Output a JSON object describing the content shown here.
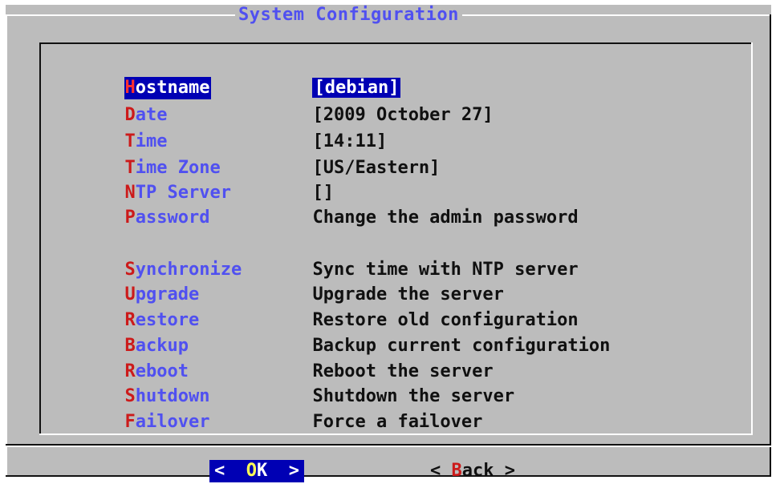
{
  "dialog": {
    "title": "System Configuration"
  },
  "menu": {
    "items": [
      {
        "hot": "H",
        "rest": "ostname",
        "value": "[debian]",
        "selected": true
      },
      {
        "hot": "D",
        "rest": "ate",
        "value": "[2009 October 27]"
      },
      {
        "hot": "T",
        "rest": "ime",
        "value": "[14:11]"
      },
      {
        "hot": "T",
        "rest": "ime Zone",
        "value": "[US/Eastern]"
      },
      {
        "hot": "N",
        "rest": "TP Server",
        "value": "[]"
      },
      {
        "hot": "P",
        "rest": "assword",
        "value": "Change the admin password"
      },
      {
        "hot": "S",
        "rest": "ynchronize",
        "value": "Sync time with NTP server"
      },
      {
        "hot": "U",
        "rest": "pgrade",
        "value": "Upgrade the server"
      },
      {
        "hot": "R",
        "rest": "estore",
        "value": "Restore old configuration"
      },
      {
        "hot": "B",
        "rest": "ackup",
        "value": "Backup current configuration"
      },
      {
        "hot": "R",
        "rest": "eboot",
        "value": "Reboot the server"
      },
      {
        "hot": "S",
        "rest": "hutdown",
        "value": "Shutdown the server"
      },
      {
        "hot": "F",
        "rest": "ailover",
        "value": "Force a failover"
      }
    ]
  },
  "buttons": {
    "ok": {
      "open": "<  ",
      "hot": "O",
      "rest": "K",
      "close": "  >"
    },
    "back": {
      "open": "< ",
      "hot": "B",
      "rest": "ack",
      "close": " >"
    }
  },
  "colors": {
    "background": "#bcbcbc",
    "title": "#5050f0",
    "hotkey": "#cc1a1a",
    "selection": "#0000b4",
    "text": "#101010"
  }
}
